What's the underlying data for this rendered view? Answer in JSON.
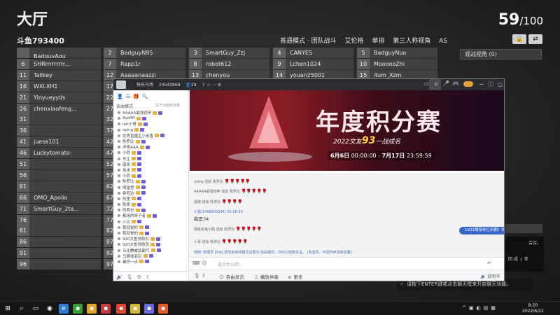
{
  "lobby": {
    "title": "大厅",
    "room_id": "斗鱼793400",
    "player_count": "59",
    "player_max": "/100",
    "modes": [
      "普通模式 · 团队战斗",
      "艾伦格",
      "单排",
      "第三人称视角",
      "AS"
    ],
    "spectate_label": "观战视角 (0)",
    "chat_hint": "请按下ENTER键或点击聊天框来开启聊天功能。",
    "side_text": "会议。",
    "side_text2": "回 成 ↓ 亚",
    "slots_col1": [
      {
        "num": "",
        "name": "BadguyAqu"
      },
      {
        "num": "6",
        "name": "SHRrrrrrrrrr..."
      },
      {
        "num": "11",
        "name": "Tallkey"
      },
      {
        "num": "16",
        "name": "WXLXH1"
      },
      {
        "num": "21",
        "name": "Yinyueyyds"
      },
      {
        "num": "26",
        "name": "chenxiaofeng..."
      },
      {
        "num": "31",
        "name": ""
      },
      {
        "num": "36",
        "name": ""
      },
      {
        "num": "41",
        "name": "juese101"
      },
      {
        "num": "46",
        "name": "Luckytomato-"
      },
      {
        "num": "51",
        "name": ""
      },
      {
        "num": "56",
        "name": ""
      },
      {
        "num": "61",
        "name": ""
      },
      {
        "num": "66",
        "name": "OMO_Apollo"
      },
      {
        "num": "71",
        "name": "SmartGuy_2ta..."
      },
      {
        "num": "76",
        "name": ""
      },
      {
        "num": "81",
        "name": ""
      },
      {
        "num": "86",
        "name": ""
      },
      {
        "num": "91",
        "name": ""
      },
      {
        "num": "96",
        "name": ""
      }
    ],
    "slots_col2": [
      {
        "num": "2",
        "name": "BadguyN95"
      },
      {
        "num": "7",
        "name": "Rapp1r"
      },
      {
        "num": "12",
        "name": "Aaaaanaazzi"
      },
      {
        "num": "17",
        "name": ""
      },
      {
        "num": "22",
        "name": ""
      },
      {
        "num": "27",
        "name": ""
      },
      {
        "num": "32",
        "name": ""
      },
      {
        "num": "37",
        "name": ""
      },
      {
        "num": "42",
        "name": ""
      },
      {
        "num": "47",
        "name": ""
      },
      {
        "num": "52",
        "name": ""
      },
      {
        "num": "57",
        "name": ""
      },
      {
        "num": "62",
        "name": ""
      },
      {
        "num": "67",
        "name": ""
      },
      {
        "num": "72",
        "name": ""
      },
      {
        "num": "77",
        "name": ""
      },
      {
        "num": "82",
        "name": ""
      },
      {
        "num": "87",
        "name": ""
      },
      {
        "num": "92",
        "name": ""
      },
      {
        "num": "97",
        "name": ""
      }
    ],
    "slots_top": [
      {
        "num": "3",
        "name": "SmartGuy_Zzj"
      },
      {
        "num": "4",
        "name": "CANYES"
      },
      {
        "num": "5",
        "name": "BadguyNuo"
      },
      {
        "num": "8",
        "name": "robot612"
      },
      {
        "num": "9",
        "name": "Lchen1024"
      },
      {
        "num": "10",
        "name": "MoooooZhi"
      },
      {
        "num": "13",
        "name": "chenyou"
      },
      {
        "num": "14",
        "name": "youan25001"
      },
      {
        "num": "15",
        "name": "4um_Xzm"
      }
    ]
  },
  "douyu": {
    "room_title": "快乐马场",
    "room_num": "24540869",
    "fans": "29",
    "left_mode": "自由模式",
    "left_note": "关于功能和流量",
    "banner_title": "年度积分赛",
    "banner_sub_prefix": "2022文友",
    "banner_sub_highlight": "93",
    "banner_sub_suffix": "一战成名",
    "banner_date_start": "6月6日",
    "banner_date_mid": "00:00:00 - ",
    "banner_date_end": "7月17日",
    "banner_date_end_time": "23:59:59",
    "left_list": [
      "AAAAA最强铠甲",
      "Aceffff",
      "lalr小哥",
      "aying",
      "优秀直播主小米香",
      "陈罗比",
      "洋哥AAA",
      "小荷",
      "车生",
      "唐哥",
      "依米",
      "小荷",
      "陈罗比",
      "明星里",
      "新阿达",
      "阿里",
      "陈哥",
      "的我也",
      "都用的哥子者",
      "小瓜",
      "我就是的",
      "我就是的",
      "920大鱼领航队",
      "920大鱼领航员",
      "马化腾威武霸气",
      "马赛球菲区",
      "秦符一点"
    ],
    "chat": [
      {
        "text": "aying 送给 陈罗比",
        "roses": "🌹🌹🌹🌹🌹"
      },
      {
        "text": "AAAAA最强铠甲 送给 陈罗比",
        "roses": "🌹🌹🌹🌹🌹"
      },
      {
        "text": "酒狼 送给 陈罗比",
        "roses": "🌹🌹🌹🌹"
      },
      {
        "text": "小黑(1498506234) 00:18:33",
        "roses": ""
      },
      {
        "text": "我是34",
        "roses": ""
      },
      {
        "text": "我就会鬼小瓶 送给 陈罗比",
        "roses": "🌹🌹🌹🌹🌹"
      },
      {
        "text": "小哥 送给 陈罗比",
        "roses": "🌹🌹🌹🌹🌹"
      }
    ],
    "system_msg": "通知: 管理员 [fu6] 把当前房间模式设置为 自由模式，你可以随意发言。 [有音效，可调节声音和音量]",
    "bubble": "1921期待你已到期！快来免费领取吧",
    "input_placeholder": "说点什么吧...",
    "bottom_items": [
      "自由发言",
      "播放伴奏",
      "更多"
    ],
    "bottom_right": "说明书"
  },
  "taskbar": {
    "time": "8:20",
    "date": "2022/6/22"
  }
}
